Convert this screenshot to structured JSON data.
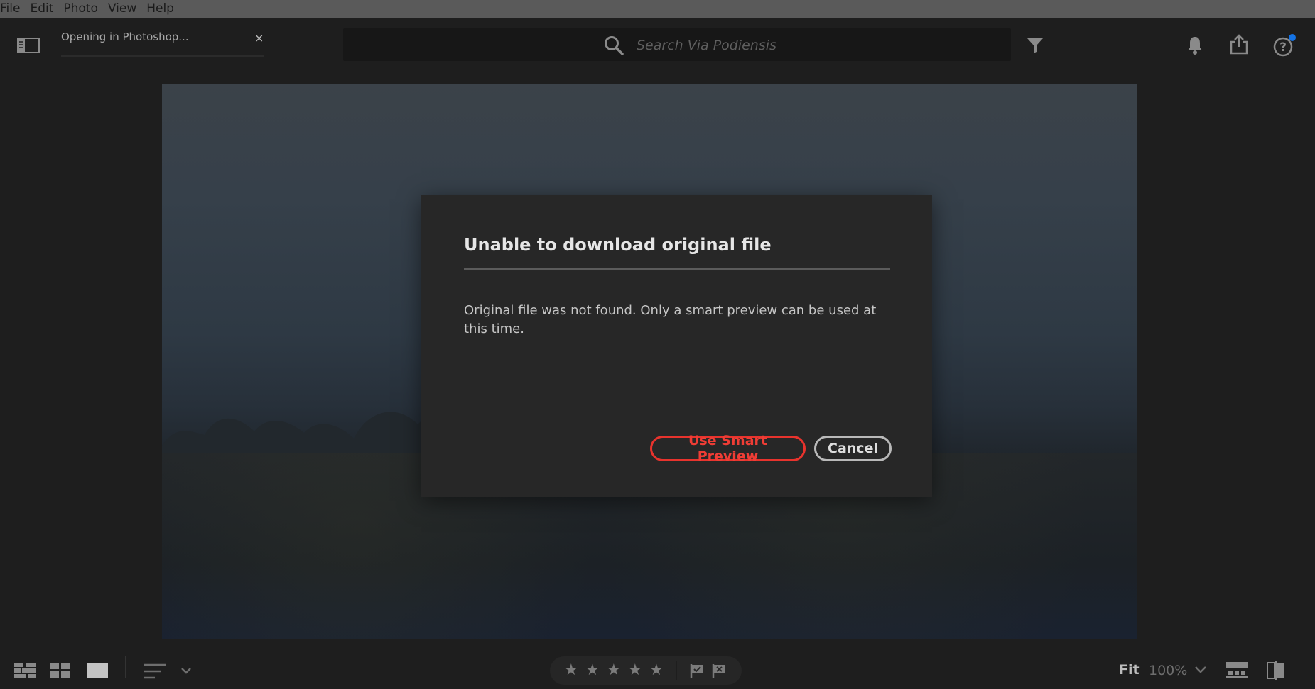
{
  "menu": [
    "File",
    "Edit",
    "Photo",
    "View",
    "Help"
  ],
  "tab": {
    "label": "Opening in Photoshop...",
    "close": "×"
  },
  "search": {
    "placeholder": "Search Via Podiensis"
  },
  "dialog": {
    "title": "Unable to download original file",
    "body": "Original file was not found. Only a smart preview can be used at this time.",
    "primary_label": "Use Smart Preview",
    "cancel_label": "Cancel"
  },
  "bottom": {
    "stars": [
      "★",
      "★",
      "★",
      "★",
      "★"
    ],
    "fit_label": "Fit",
    "zoom_label": "100%"
  },
  "colors": {
    "accent": "#e8332d",
    "help_badge": "#1473e6",
    "dialog_bg": "#272727",
    "menubar_bg": "#5a5a5a"
  },
  "icons": {
    "panel": "panel-toggle-icon",
    "search": "search-icon",
    "filter": "filter-icon",
    "bell": "bell-icon",
    "share": "share-icon",
    "help": "help-icon",
    "square_grid": "square-grid-icon",
    "photo_grid": "photo-grid-icon",
    "detail": "detail-view-icon",
    "sort": "sort-icon",
    "flag_pick": "flag-pick-icon",
    "flag_reject": "flag-reject-icon",
    "filmstrip": "filmstrip-icon",
    "compare": "compare-icon"
  }
}
